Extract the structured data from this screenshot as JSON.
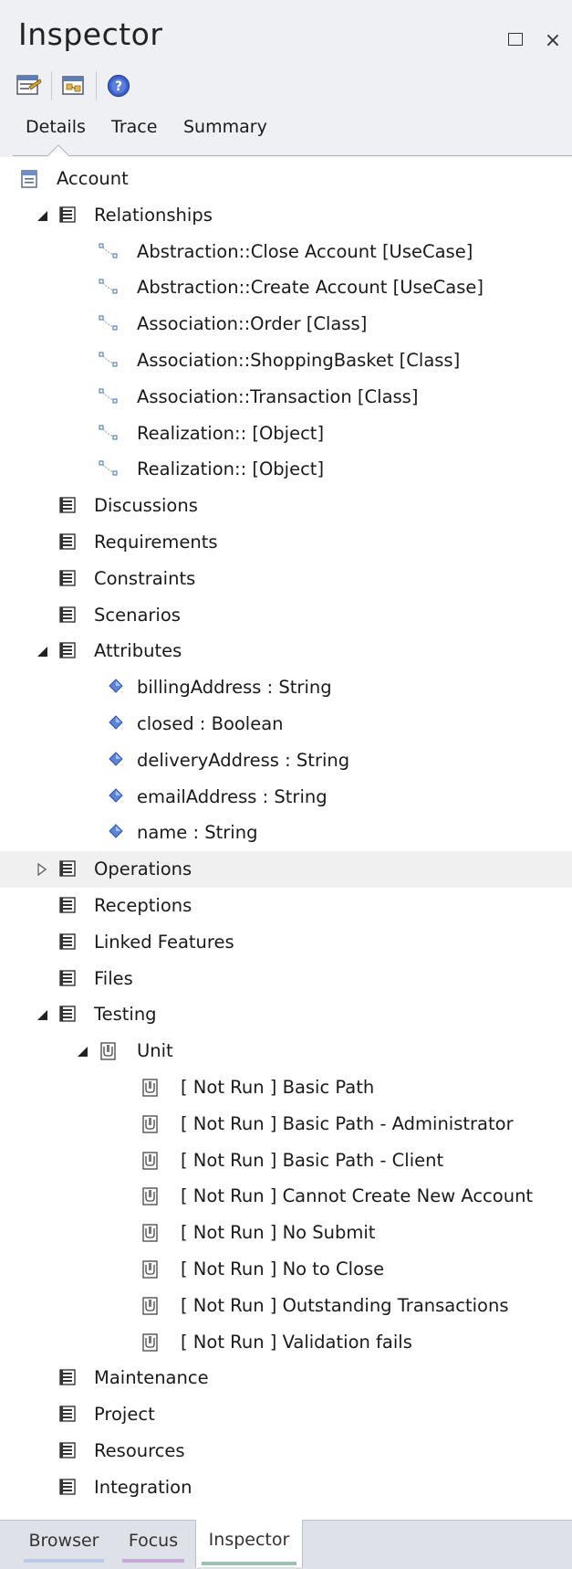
{
  "window": {
    "title": "Inspector",
    "restore_label": "",
    "close_label": "×"
  },
  "toolbar": {
    "buttons": [
      {
        "icon": "element-properties-icon"
      },
      {
        "icon": "diagram-properties-icon"
      },
      {
        "icon": "help-icon"
      }
    ]
  },
  "tabs": [
    {
      "label": "Details",
      "active": true
    },
    {
      "label": "Trace",
      "active": false
    },
    {
      "label": "Summary",
      "active": false
    }
  ],
  "tree": {
    "root": "Account",
    "relationships_label": "Relationships",
    "relationships": [
      "Abstraction::Close Account [UseCase]",
      "Abstraction::Create Account [UseCase]",
      "Association::Order [Class]",
      "Association::ShoppingBasket [Class]",
      "Association::Transaction [Class]",
      "Realization:: [Object]",
      "Realization:: [Object]"
    ],
    "discussions_label": "Discussions",
    "requirements_label": "Requirements",
    "constraints_label": "Constraints",
    "scenarios_label": "Scenarios",
    "attributes_label": "Attributes",
    "attributes": [
      "billingAddress : String",
      "closed : Boolean",
      "deliveryAddress : String",
      "emailAddress : String",
      "name : String"
    ],
    "operations_label": "Operations",
    "receptions_label": "Receptions",
    "linked_features_label": "Linked Features",
    "files_label": "Files",
    "testing_label": "Testing",
    "unit_label": "Unit",
    "tests": [
      "[ Not Run ] Basic Path",
      "[ Not Run ] Basic Path - Administrator",
      "[ Not Run ] Basic Path - Client",
      "[ Not Run ] Cannot Create New Account",
      "[ Not Run ] No Submit",
      "[ Not Run ] No to Close",
      "[ Not Run ] Outstanding Transactions",
      "[ Not Run ] Validation fails"
    ],
    "maintenance_label": "Maintenance",
    "project_label": "Project",
    "resources_label": "Resources",
    "integration_label": "Integration"
  },
  "bottom_tabs": [
    {
      "label": "Browser",
      "color": "#b9cbe6"
    },
    {
      "label": "Focus",
      "color": "#c7a8d8"
    },
    {
      "label": "Inspector",
      "color": "#9bbfb3"
    }
  ]
}
